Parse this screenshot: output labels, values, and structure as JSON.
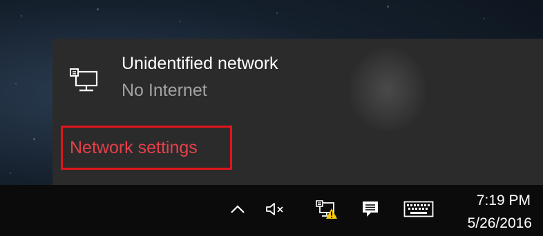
{
  "colors": {
    "flyout_bg": "#2b2b2b",
    "taskbar_bg": "#0b0b0b",
    "accent_link": "#e5404a",
    "highlight_border": "#e3141b",
    "primary_text": "#ffffff",
    "secondary_text": "#a3a3a3",
    "warning": "#f7c70a"
  },
  "network_flyout": {
    "network": {
      "icon": "wired-network-icon",
      "name": "Unidentified network",
      "status": "No Internet"
    },
    "settings_link": "Network settings"
  },
  "taskbar": {
    "tray": {
      "icons": [
        "show-hidden-icons-chevron-icon",
        "volume-muted-icon",
        "network-warning-icon",
        "action-center-icon",
        "touch-keyboard-icon"
      ]
    },
    "clock": {
      "time": "7:19 PM",
      "date": "5/26/2016"
    }
  }
}
